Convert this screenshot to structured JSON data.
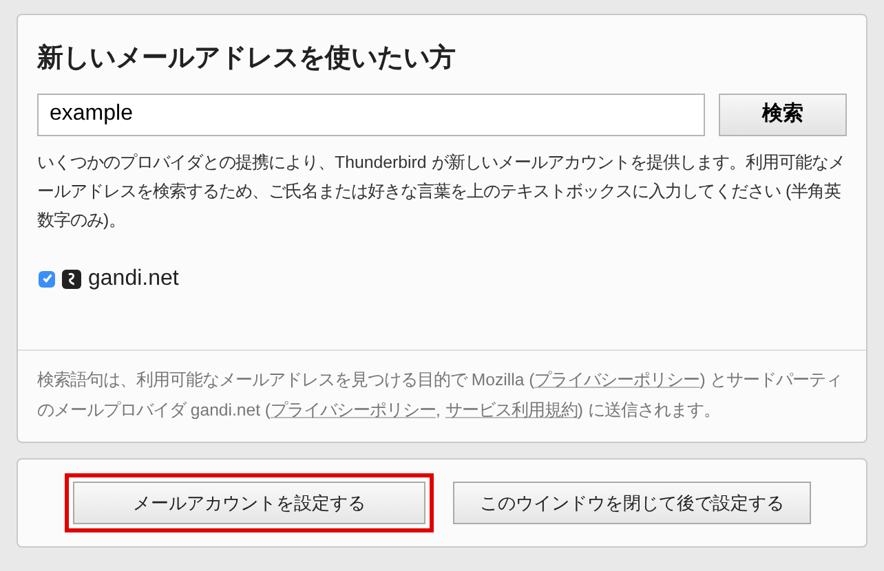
{
  "title": "新しいメールアドレスを使いたい方",
  "search": {
    "value": "example",
    "button": "検索"
  },
  "description": "いくつかのプロバイダとの提携により、Thunderbird が新しいメールアカウントを提供します。利用可能なメールアドレスを検索するため、ご氏名または好きな言葉を上のテキストボックスに入力してください (半角英数字のみ)。",
  "providers": [
    {
      "name": "gandi.net",
      "checked": true
    }
  ],
  "notice": [
    {
      "kind": "text",
      "text": "検索語句は、利用可能なメールアドレスを見つける目的で Mozilla ("
    },
    {
      "kind": "link",
      "text": "プライバシーポリシー"
    },
    {
      "kind": "text",
      "text": ") とサードパーティのメールプロバイダ gandi.net ("
    },
    {
      "kind": "link",
      "text": "プライバシーポリシー"
    },
    {
      "kind": "text",
      "text": ", "
    },
    {
      "kind": "link",
      "text": "サービス利用規約"
    },
    {
      "kind": "text",
      "text": ") に送信されます。"
    }
  ],
  "buttons": [
    {
      "label": "メールアカウントを設定する",
      "highlighted": true
    },
    {
      "label": "このウインドウを閉じて後で設定する",
      "highlighted": false
    }
  ]
}
